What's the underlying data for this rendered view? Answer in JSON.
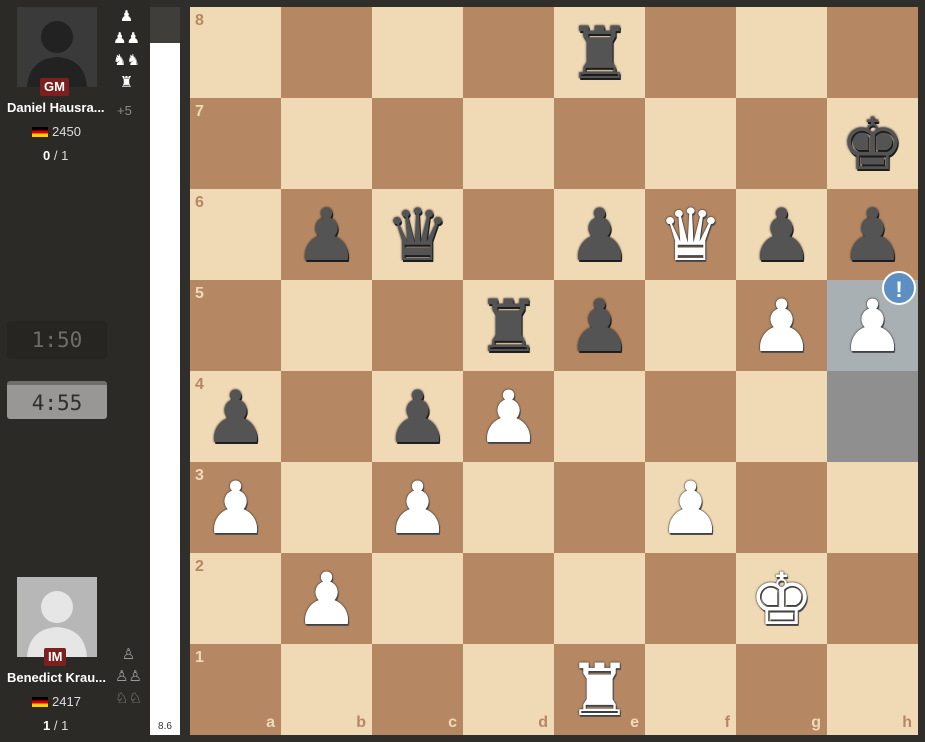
{
  "top_player": {
    "title": "GM",
    "name": "Daniel Hausra...",
    "rating": "2450",
    "score_won": "0",
    "score_total": " / 1",
    "captured": [
      "♟",
      "♟♟",
      "♞♞",
      "♜"
    ],
    "material": "+5",
    "clock": "1:50"
  },
  "bottom_player": {
    "title": "IM",
    "name": "Benedict Krau...",
    "rating": "2417",
    "score_won": "1",
    "score_total": " / 1",
    "captured": [
      "♙",
      "♙♙",
      "♘♘"
    ],
    "clock": "4:55"
  },
  "eval_bar": {
    "value": "8.6",
    "black_fraction": 0.05
  },
  "board": {
    "files": [
      "a",
      "b",
      "c",
      "d",
      "e",
      "f",
      "g",
      "h"
    ],
    "ranks": [
      "8",
      "7",
      "6",
      "5",
      "4",
      "3",
      "2",
      "1"
    ],
    "rows": [
      [
        "",
        "",
        "",
        "",
        "r",
        "",
        "",
        ""
      ],
      [
        "",
        "",
        "",
        "",
        "",
        "",
        "",
        "k"
      ],
      [
        "",
        "p",
        "q",
        "",
        "p",
        "Q",
        "p",
        "p"
      ],
      [
        "",
        "",
        "",
        "r",
        "p",
        "",
        "P",
        "P"
      ],
      [
        "p",
        "",
        "p",
        "P",
        "",
        "",
        "",
        ""
      ],
      [
        "P",
        "",
        "P",
        "",
        "",
        "P",
        "",
        ""
      ],
      [
        "",
        "P",
        "",
        "",
        "",
        "",
        "K",
        ""
      ],
      [
        "",
        "",
        "",
        "",
        "R",
        "",
        "",
        ""
      ]
    ],
    "highlight_squares": [
      "h5",
      "h4"
    ],
    "move_annotation": {
      "square": "h5",
      "symbol": "!"
    }
  },
  "icons": {
    "flag": "germany-flag-icon",
    "avatar": "user-avatar-icon"
  }
}
